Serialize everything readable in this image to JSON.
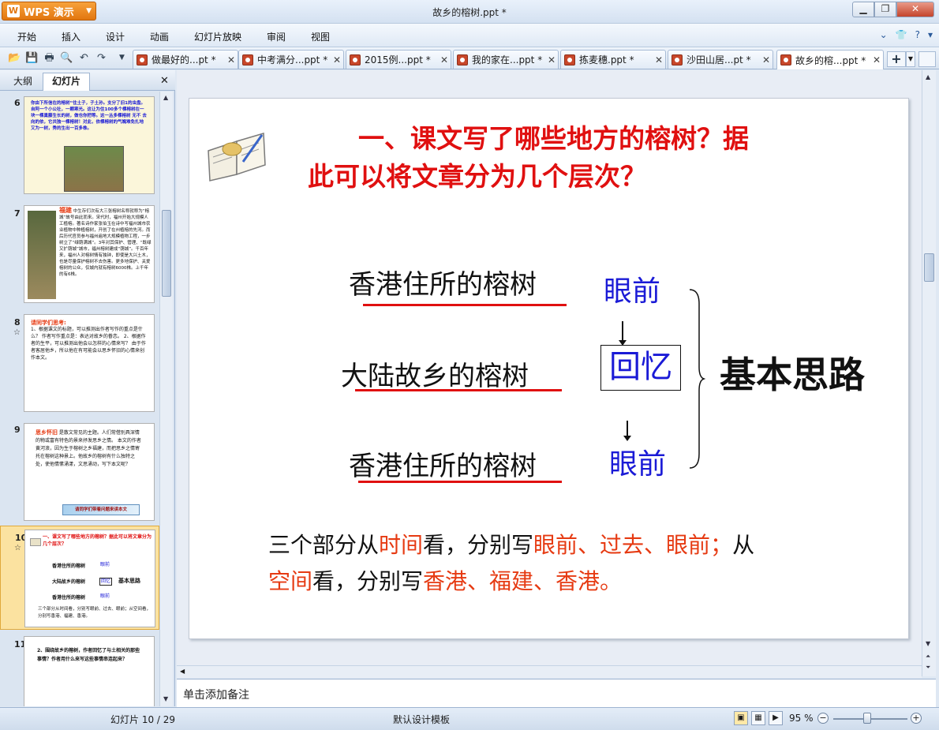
{
  "app": {
    "logo_label": "WPS 演示",
    "window_title": "故乡的榕树.ppt *"
  },
  "menu": {
    "items": [
      "开始",
      "插入",
      "设计",
      "动画",
      "幻灯片放映",
      "审阅",
      "视图"
    ]
  },
  "tabs": [
    {
      "label": "做最好的...pt *"
    },
    {
      "label": "中考满分...ppt *"
    },
    {
      "label": "2015例...ppt *"
    },
    {
      "label": "我的家在...ppt *"
    },
    {
      "label": "拣麦穗.ppt *"
    },
    {
      "label": "沙田山居...pt *"
    },
    {
      "label": "故乡的榕...ppt *",
      "active": true
    }
  ],
  "left_panel": {
    "tab_outline": "大纲",
    "tab_slides": "幻灯片",
    "thumbnails": [
      {
        "num": "6",
        "text": "你由下所信在的榕树“住土子，子土孙。支分了旧1的虫盘。自阿一个小公社，一颗寒光。这让为住100多个棵榕树在一块一棵巢藤生长的树，做也你把等。这一丛多棵榕树 无不 去向的依，它共独一棵榕树！对此，依棵榕树的气魄难免扎地又为一树，秀的生出一百多株。"
      },
      {
        "num": "7",
        "heading": "福建",
        "text": "中生存们次有大三张榕树名称就称为“榕城”故号由此而来。宋代时，福州开始大规模人工植榕。著名诗作家张伯玉在诗中写福州城市农业植物中种植榕树，开创了在州植榕的先河。而后历代官员参与福州遍地大规模植物工程，一步树立了“绿荫满城”。3年对其保护、管理、“既绿又扩荫城”城市，福州榕树建成“荫城”。千百年来，福州人对榕树情有独钟，即使是大兴土木，也是尽量保护榕树不去伤害。更多地保护、关爱榕树的公众，仅城内就有榕树6000株。上千年的有6株。"
      },
      {
        "num": "8",
        "star": true,
        "heading": "请同学们思考:",
        "text": "1、根据课文的标题，可以推测出作者写作的重点是什么？ 作者写作重点是：表达对故乡的眷恋。 2、根据作者的生平，可以推测出他会以怎样的心情来写？ 由于作者客居他乡，所以他在有可能会以思乡怀旧的心情来创作本文。"
      },
      {
        "num": "9",
        "heading": "思乡怀旧",
        "text": "是散文常见的主题。人们常借别具深情的物或富有特色的景来抒发思乡之情。 本文的作者黄河浪，因为生于榕树之乡福建，而把思乡之情寄托在榕树这种景上。他故乡的榕树有什么独特之处，使他情愫涌漾，文思涌动，写下本文呢？",
        "button": "请同学们带着问题来读本文"
      },
      {
        "num": "10",
        "star": true,
        "selected": true
      },
      {
        "num": "11",
        "text": "2、围绕故乡的榕树，作者回忆了与土相关的那些事情？作者用什么来写这些事情串连起来？"
      }
    ]
  },
  "slide": {
    "title_line1": "一、课文写了哪些地方的榕树？据",
    "title_line2": "此可以将文章分为几个层次？",
    "place1": "香港住所的榕树",
    "place2": "大陆故乡的榕树",
    "place3": "香港住所的榕树",
    "label_now1": "眼前",
    "label_memory": "回忆",
    "label_now2": "眼前",
    "summary": "基本思路",
    "body_line1": [
      {
        "t": "三个部分从",
        "c": "black"
      },
      {
        "t": "时间",
        "c": "red"
      },
      {
        "t": "看，分别写",
        "c": "black"
      },
      {
        "t": "眼前、过去、眼前；",
        "c": "red"
      },
      {
        "t": "从",
        "c": "black"
      }
    ],
    "body_line2": [
      {
        "t": "空间",
        "c": "red"
      },
      {
        "t": "看，分别写",
        "c": "black"
      },
      {
        "t": "香港、福建、香港。",
        "c": "red"
      }
    ]
  },
  "thumb10": {
    "title": "一、课文写了哪些地方的榕树？据此可以将文章分为几个层次？",
    "place1": "香港住所的榕树",
    "place2": "大陆故乡的榕树",
    "place3": "香港住所的榕树",
    "now1": "眼前",
    "memory": "回忆",
    "now2": "眼前",
    "summary": "基本思路",
    "body": "三个部分从时间看，分别写眼前、过去、眼前；从空间看，分别写香港、福建、香港。"
  },
  "notes": {
    "placeholder": "单击添加备注"
  },
  "status": {
    "slide_count": "幻灯片 10 / 29",
    "template": "默认设计模板",
    "zoom": "95 %"
  },
  "colors": {
    "accent_orange": "#e2760f",
    "title_red": "#e01010",
    "label_blue": "#1a1ad6"
  }
}
